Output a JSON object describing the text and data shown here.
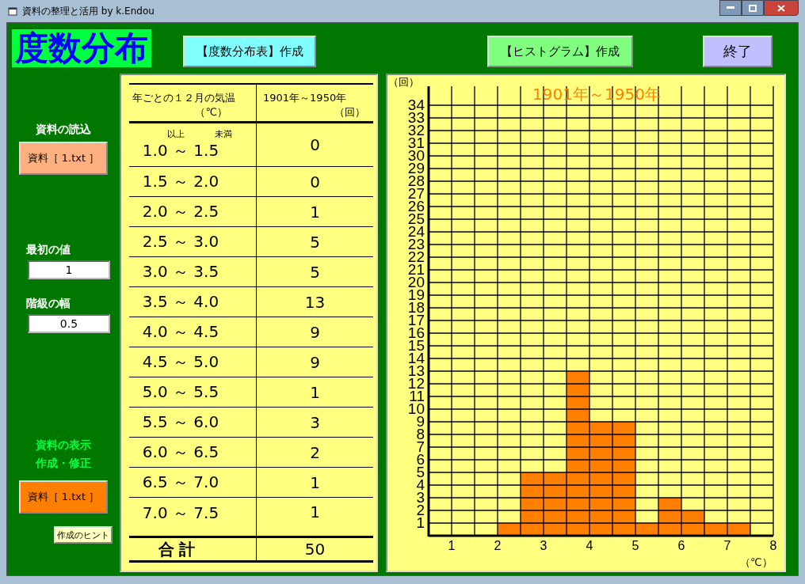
{
  "window": {
    "title": "資料の整理と活用  by k.Endou"
  },
  "heading": "度数分布",
  "toolbar": [
    {
      "label": "【度数分布表】作成",
      "kind": "table"
    },
    {
      "label": "【ヒストグラム】作成",
      "kind": "histogram"
    },
    {
      "label": "終了",
      "kind": "exit"
    }
  ],
  "sidebar": {
    "load_label": "資料の読込",
    "load_button": "資料［ 1.txt ］",
    "first_value_label": "最初の値",
    "first_value": "1",
    "width_label": "階級の幅",
    "width_value": "0.5",
    "display_label": [
      "資料の表示",
      "作成・修正"
    ],
    "edit_button": "資料［ 1.txt ］",
    "hint_button": "作成のヒント"
  },
  "table": {
    "columns": [
      {
        "title": "年ごとの１２月の気温",
        "unit": "（℃）"
      },
      {
        "title": "1901年～1950年",
        "unit": "（回）"
      }
    ],
    "subheaders": [
      "以上",
      "未満"
    ],
    "rows": [
      {
        "range": "1.0 ～ 1.5",
        "count": "0"
      },
      {
        "range": "1.5 ～ 2.0",
        "count": "0"
      },
      {
        "range": "2.0 ～ 2.5",
        "count": "1"
      },
      {
        "range": "2.5 ～ 3.0",
        "count": "5"
      },
      {
        "range": "3.0 ～ 3.5",
        "count": "5"
      },
      {
        "range": "3.5 ～ 4.0",
        "count": "13"
      },
      {
        "range": "4.0 ～ 4.5",
        "count": "9"
      },
      {
        "range": "4.5 ～ 5.0",
        "count": "9"
      },
      {
        "range": "5.0 ～ 5.5",
        "count": "1"
      },
      {
        "range": "5.5 ～ 6.0",
        "count": "3"
      },
      {
        "range": "6.0 ～ 6.5",
        "count": "2"
      },
      {
        "range": "6.5 ～ 7.0",
        "count": "1"
      },
      {
        "range": "7.0 ～ 7.5",
        "count": "1"
      }
    ],
    "total": {
      "label": "合 計",
      "value": "50"
    }
  },
  "histogram": {
    "chart_data": {
      "type": "bar",
      "grid": true,
      "title": "1901年～1950年",
      "xlabel": "（℃）",
      "ylabel": "（回）",
      "x": [
        0.75,
        1.25,
        1.75,
        2.25,
        2.75,
        3.25,
        3.75,
        4.25,
        4.75,
        5.25,
        5.75,
        6.25,
        6.75,
        7.25,
        7.75
      ],
      "values": [
        0,
        0,
        0,
        1,
        5,
        5,
        13,
        9,
        9,
        1,
        3,
        2,
        1,
        1,
        0
      ],
      "xlim": [
        0.5,
        8
      ],
      "ylim": [
        0,
        35.5
      ],
      "xticks": [
        1,
        2,
        3,
        4,
        5,
        6,
        7,
        8
      ],
      "yticks": [
        1,
        2,
        3,
        4,
        5,
        6,
        7,
        8,
        9,
        10,
        11,
        12,
        13,
        14,
        15,
        16,
        17,
        18,
        19,
        20,
        21,
        22,
        23,
        24,
        25,
        26,
        27,
        28,
        29,
        30,
        31,
        32,
        33,
        34
      ]
    }
  }
}
